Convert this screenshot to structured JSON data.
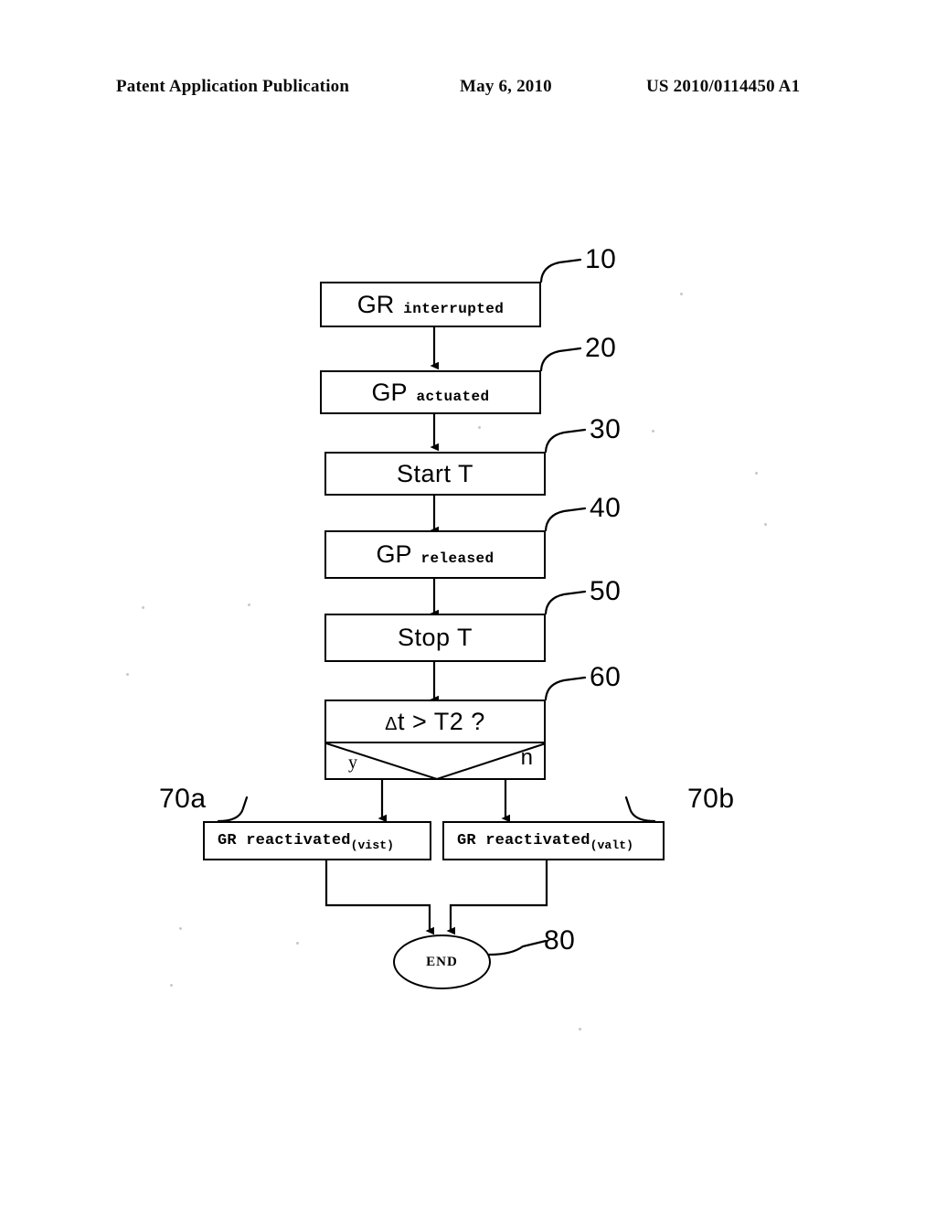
{
  "page": {
    "header": {
      "publication": "Patent Application Publication",
      "date": "May 6, 2010",
      "doc_number": "US 2010/0114450 A1"
    },
    "background_color": "#ffffff",
    "ink_color": "#000000"
  },
  "figure": {
    "type": "flowchart",
    "nodes": [
      {
        "ref": "10",
        "shape": "rectangle",
        "head": "GR",
        "tail": "interrupted"
      },
      {
        "ref": "20",
        "shape": "rectangle",
        "head": "GP",
        "tail": "actuated"
      },
      {
        "ref": "30",
        "shape": "rectangle",
        "text": "Start T"
      },
      {
        "ref": "40",
        "shape": "rectangle",
        "head": "GP",
        "tail": "released"
      },
      {
        "ref": "50",
        "shape": "rectangle",
        "text": "Stop  T"
      },
      {
        "ref": "60",
        "shape": "decision",
        "delta": "Δ",
        "text": "t > T2 ?",
        "yes_label": "y",
        "no_label": "n"
      },
      {
        "ref": "70a",
        "shape": "rectangle",
        "text": "GR reactivated",
        "subscript": "(vist)"
      },
      {
        "ref": "70b",
        "shape": "rectangle",
        "text": "GR reactivated",
        "subscript": "(valt)"
      },
      {
        "ref": "80",
        "shape": "oval",
        "text": "END"
      }
    ]
  }
}
